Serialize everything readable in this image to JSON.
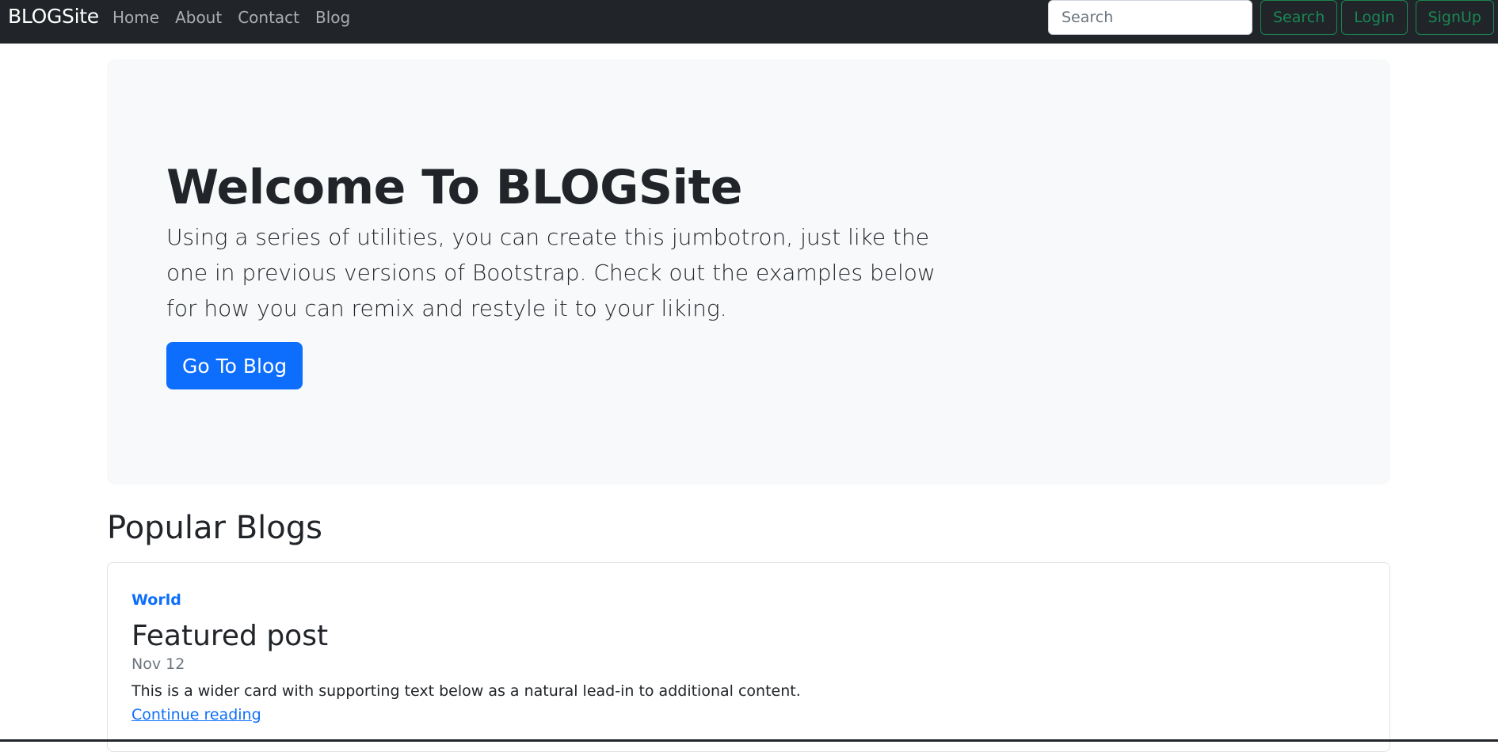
{
  "navbar": {
    "brand": "BLOGSite",
    "links": [
      "Home",
      "About",
      "Contact",
      "Blog"
    ],
    "search": {
      "placeholder": "Search",
      "value": ""
    },
    "search_button": "Search",
    "login_button": "Login",
    "signup_button": "SignUp"
  },
  "hero": {
    "title": "Welcome To BLOGSite",
    "lead": "Using a series of utilities, you can create this jumbotron, just like the one in previous versions of Bootstrap. Check out the examples below for how you can remix and restyle it to your liking.",
    "button": "Go To Blog"
  },
  "popular": {
    "title": "Popular Blogs",
    "card": {
      "category": "World",
      "title": "Featured post",
      "date": "Nov 12",
      "text": "This is a wider card with supporting text below as a natural lead-in to additional content.",
      "link": "Continue reading"
    }
  },
  "colors": {
    "navbar_bg": "#212529",
    "primary": "#0d6efd",
    "success": "#198754",
    "jumbotron_bg": "#f8f9fa"
  }
}
